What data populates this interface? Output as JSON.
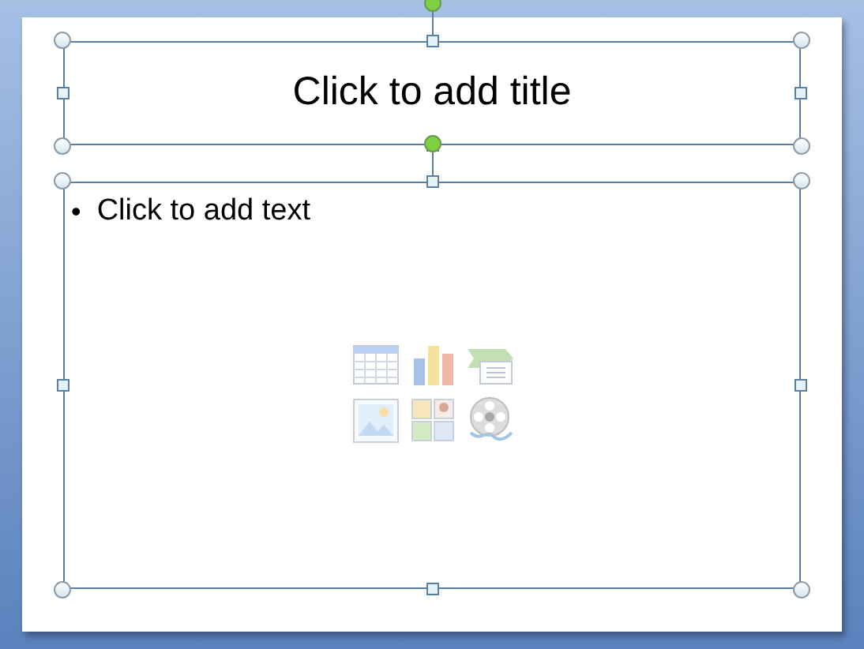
{
  "title_placeholder": {
    "text": "Click to add title",
    "selected": true
  },
  "body_placeholder": {
    "bullet": "•",
    "text": "Click to add text",
    "selected": true
  }
}
